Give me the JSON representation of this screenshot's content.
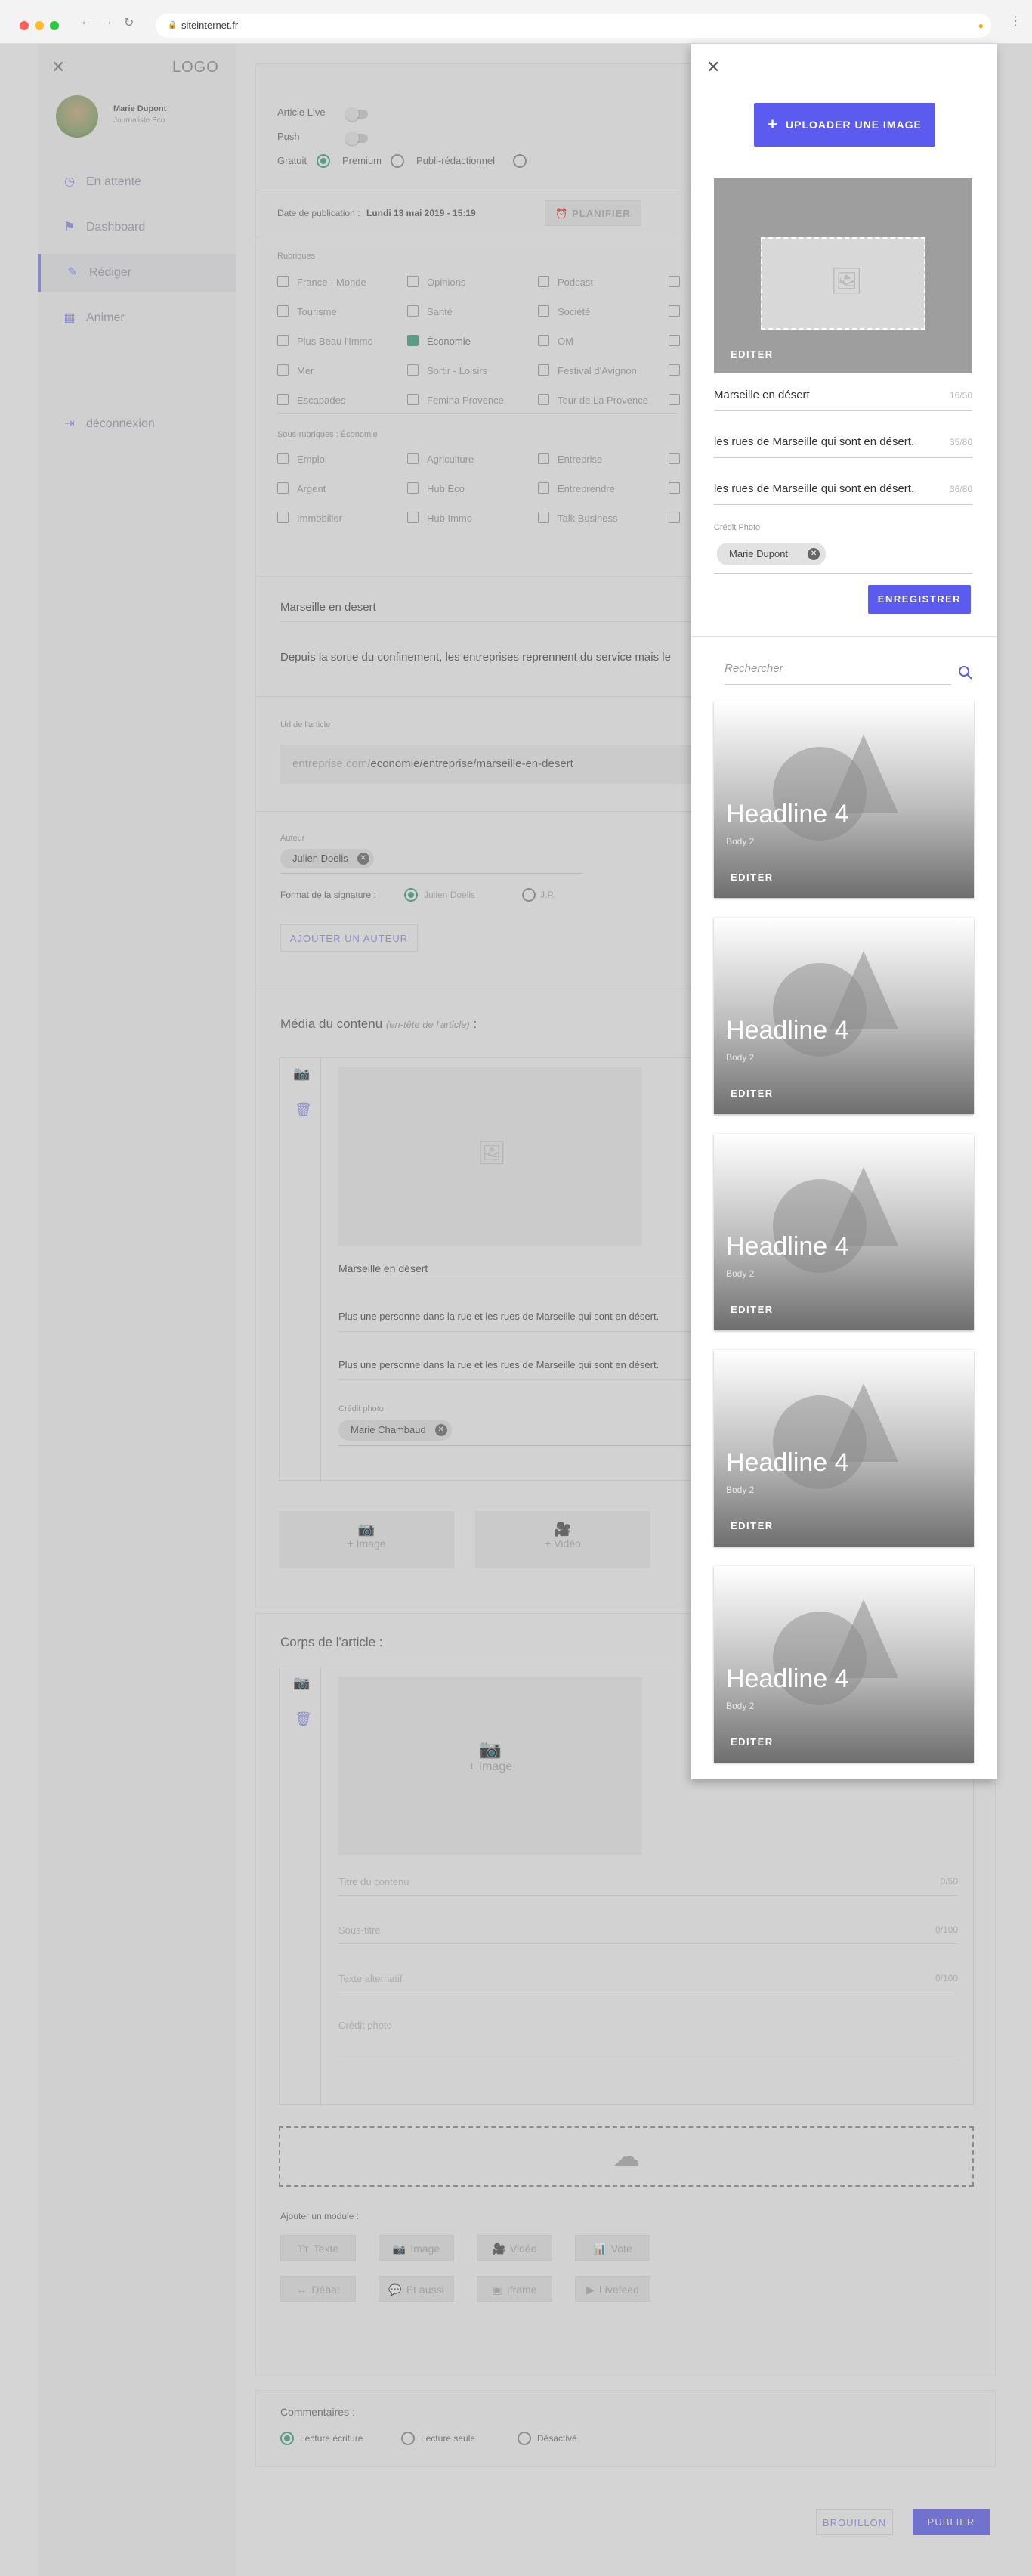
{
  "browser": {
    "url": "siteinternet.fr"
  },
  "sidebar": {
    "logo": "LOGO",
    "user_name": "Marie Dupont",
    "user_role": "Journaliste Eco",
    "items": [
      {
        "label": "En attente",
        "icon": "clock-icon"
      },
      {
        "label": "Dashboard",
        "icon": "flag-icon"
      },
      {
        "label": "Rédiger",
        "icon": "pencil-icon"
      },
      {
        "label": "Animer",
        "icon": "grid-icon"
      },
      {
        "label": "déconnexion",
        "icon": "logout-icon"
      }
    ]
  },
  "article": {
    "live_label": "Article Live",
    "push_label": "Push",
    "access": [
      "Gratuit",
      "Premium",
      "Publi-rédactionnel"
    ],
    "pub_date_label": "Date de publication :",
    "pub_date": "Lundi 13 mai 2019 - 15:19",
    "plan_btn": "PLANIFIER",
    "rubriques_label": "Rubriques",
    "rubriques": [
      [
        "France - Monde",
        "Opinions",
        "Podcast"
      ],
      [
        "Tourisme",
        "Santé",
        "Société"
      ],
      [
        "Plus Beau l'Immo",
        "Économie",
        "OM"
      ],
      [
        "Mer",
        "Sortir - Loisirs",
        "Festival d'Avignon"
      ],
      [
        "Escapades",
        "Femina Provence",
        "Tour de La Provence"
      ]
    ],
    "sous_label": "Sous-rubriques : Économie",
    "sous": [
      [
        "Emploi",
        "Agriculture",
        "Entreprise"
      ],
      [
        "Argent",
        "Hub Eco",
        "Entreprendre"
      ],
      [
        "Immobilier",
        "Hub Immo",
        "Talk Business"
      ]
    ],
    "title": "Marseille en desert",
    "lead": "Depuis la sortie du confinement, les entreprises reprennent du service mais le",
    "url_label": "Url de l'article",
    "url_base": "entreprise.com/",
    "url_path": "economie/entreprise/marseille-en-desert",
    "author_label": "Auteur",
    "author": "Julien Doelis",
    "signature_label": "Format de la signature :",
    "sig_opts": [
      "Julien Doelis",
      "J.P."
    ],
    "add_author": "AJOUTER UN AUTEUR"
  },
  "media": {
    "title": "Média du contenu",
    "title_note": "(en-tête de l'article)",
    "title_suffix": ":",
    "img_title": "Marseille en désert",
    "line1": "Plus une personne dans la rue et les rues de Marseille qui sont en désert.",
    "line2": "Plus une personne dans la rue et les rues de Marseille qui sont en désert.",
    "credit_label": "Crédit photo",
    "credit": "Marie Chambaud",
    "btn_image": "Image",
    "btn_video": "Vidéo"
  },
  "body": {
    "title": "Corps de l'article :",
    "image_label": "Image",
    "f1": "Titre du contenu",
    "f1c": "0/50",
    "f2": "Sous-titre",
    "f2c": "0/100",
    "f3": "Texte alternatif",
    "f3c": "0/100",
    "f4": "Crédit photo",
    "add_module": "Ajouter un module :",
    "modules": [
      "Texte",
      "Image",
      "Vidéo",
      "Vote",
      "Débat",
      "Et aussi",
      "Iframe",
      "Livefeed"
    ]
  },
  "comments": {
    "label": "Commentaires :",
    "opts": [
      "Lecture écriture",
      "Lecture seule",
      "Désactivé"
    ]
  },
  "footer": {
    "draft": "BROUILLON",
    "publish": "PUBLIER"
  },
  "panel": {
    "upload": "UPLOADER UNE IMAGE",
    "edit": "EDITER",
    "title": "Marseille en désert",
    "title_count": "16/50",
    "sub": "les rues de Marseille qui sont en désert.",
    "sub_count": "35/80",
    "alt": "les rues de Marseille qui sont en désert.",
    "alt_count": "36/80",
    "credit_label": "Crédit Photo",
    "credit": "Marie Dupont",
    "save": "ENREGISTRER",
    "search_placeholder": "Rechercher",
    "tiles": [
      {
        "headline": "Headline 4",
        "body": "Body 2",
        "edit": "EDITER"
      },
      {
        "headline": "Headline 4",
        "body": "Body 2",
        "edit": "EDITER"
      },
      {
        "headline": "Headline 4",
        "body": "Body 2",
        "edit": "EDITER"
      },
      {
        "headline": "Headline 4",
        "body": "Body 2",
        "edit": "EDITER"
      },
      {
        "headline": "Headline 4",
        "body": "Body 2",
        "edit": "EDITER"
      }
    ]
  },
  "colors": {
    "accent": "#5b5bf0",
    "check": "#3aa07a"
  }
}
